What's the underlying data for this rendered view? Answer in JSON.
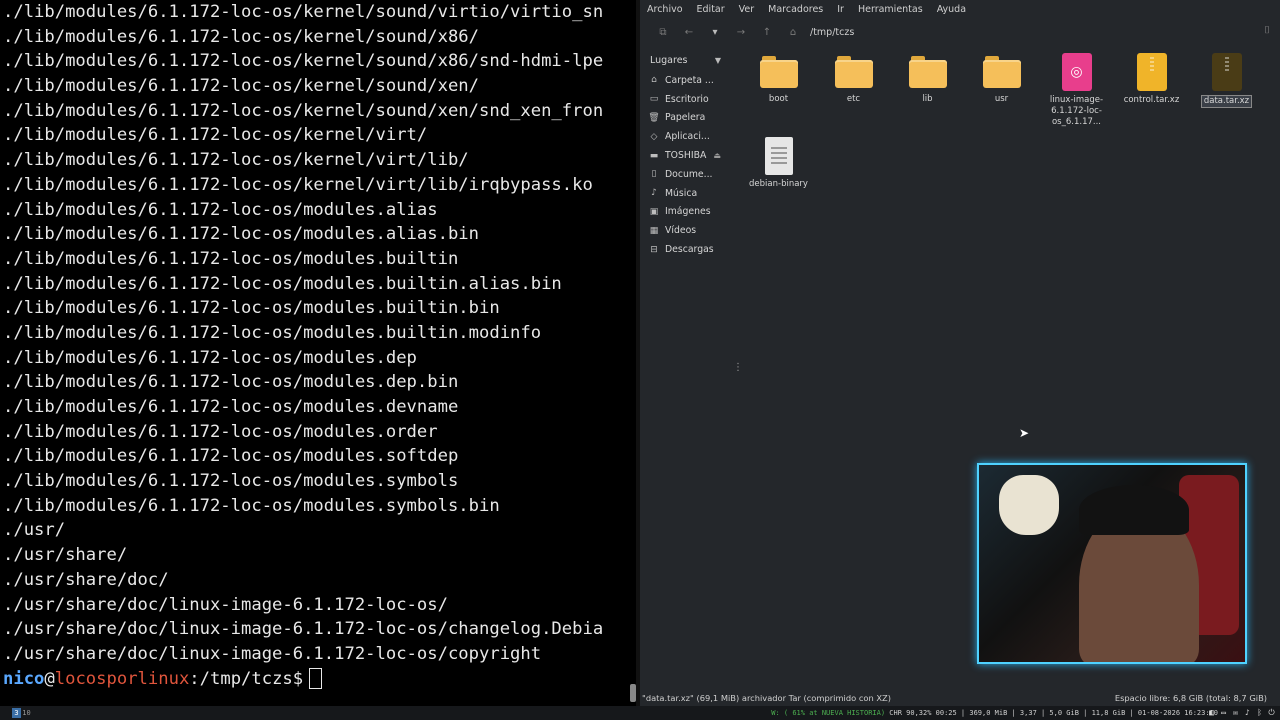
{
  "terminal": {
    "lines": [
      "./lib/modules/6.1.172-loc-os/kernel/sound/virtio/virtio_sn",
      "./lib/modules/6.1.172-loc-os/kernel/sound/x86/",
      "./lib/modules/6.1.172-loc-os/kernel/sound/x86/snd-hdmi-lpe",
      "./lib/modules/6.1.172-loc-os/kernel/sound/xen/",
      "./lib/modules/6.1.172-loc-os/kernel/sound/xen/snd_xen_fron",
      "./lib/modules/6.1.172-loc-os/kernel/virt/",
      "./lib/modules/6.1.172-loc-os/kernel/virt/lib/",
      "./lib/modules/6.1.172-loc-os/kernel/virt/lib/irqbypass.ko",
      "./lib/modules/6.1.172-loc-os/modules.alias",
      "./lib/modules/6.1.172-loc-os/modules.alias.bin",
      "./lib/modules/6.1.172-loc-os/modules.builtin",
      "./lib/modules/6.1.172-loc-os/modules.builtin.alias.bin",
      "./lib/modules/6.1.172-loc-os/modules.builtin.bin",
      "./lib/modules/6.1.172-loc-os/modules.builtin.modinfo",
      "./lib/modules/6.1.172-loc-os/modules.dep",
      "./lib/modules/6.1.172-loc-os/modules.dep.bin",
      "./lib/modules/6.1.172-loc-os/modules.devname",
      "./lib/modules/6.1.172-loc-os/modules.order",
      "./lib/modules/6.1.172-loc-os/modules.softdep",
      "./lib/modules/6.1.172-loc-os/modules.symbols",
      "./lib/modules/6.1.172-loc-os/modules.symbols.bin",
      "./usr/",
      "./usr/share/",
      "./usr/share/doc/",
      "./usr/share/doc/linux-image-6.1.172-loc-os/",
      "./usr/share/doc/linux-image-6.1.172-loc-os/changelog.Debia",
      "./usr/share/doc/linux-image-6.1.172-loc-os/copyright"
    ],
    "prompt": {
      "user": "nico",
      "at": "@",
      "host": "locosporlinux",
      "path": ":/tmp/tczs",
      "symbol": "$"
    }
  },
  "file_manager": {
    "menu": [
      "Archivo",
      "Editar",
      "Ver",
      "Marcadores",
      "Ir",
      "Herramientas",
      "Ayuda"
    ],
    "path": "/tmp/tczs",
    "sidebar_heading": "Lugares",
    "places": [
      {
        "label": "Carpeta ...",
        "icon": "home-icon"
      },
      {
        "label": "Escritorio",
        "icon": "desktop-icon"
      },
      {
        "label": "Papelera",
        "icon": "trash-icon"
      },
      {
        "label": "Aplicaci...",
        "icon": "applications-icon"
      },
      {
        "label": "TOSHIBA",
        "icon": "drive-icon"
      },
      {
        "label": "Docume...",
        "icon": "document-icon"
      },
      {
        "label": "Música",
        "icon": "music-icon"
      },
      {
        "label": "Imágenes",
        "icon": "image-icon"
      },
      {
        "label": "Vídeos",
        "icon": "video-icon"
      },
      {
        "label": "Descargas",
        "icon": "download-icon"
      }
    ],
    "files": [
      {
        "name": "boot",
        "type": "folder"
      },
      {
        "name": "etc",
        "type": "folder"
      },
      {
        "name": "lib",
        "type": "folder"
      },
      {
        "name": "usr",
        "type": "folder"
      },
      {
        "name": "linux-image-6.1.172-loc-os_6.1.17...",
        "type": "deb"
      },
      {
        "name": "control.tar.xz",
        "type": "archive"
      },
      {
        "name": "data.tar.xz",
        "type": "archive-selected"
      },
      {
        "name": "debian-binary",
        "type": "text"
      }
    ],
    "status_left": "\"data.tar.xz\" (69,1 MiB) archivador Tar (comprimido con XZ)",
    "status_right": "Espacio libre: 6,8 GiB (total: 8,7 GiB)"
  },
  "taskbar": {
    "workspaces": [
      "3",
      "10"
    ],
    "status_green": "W: ( 61% at NUEVA HISTORIA)",
    "status_rest": " CHR 90,32% 00:25 | 369,0 MiB | 3,37 | 5,0 GiB | 11,8 GiB | 01-08-2026 16:23:10"
  },
  "colors": {
    "prompt_user": "#5aa8ff",
    "prompt_host": "#e0553c",
    "webcam_border": "#4fd2ff",
    "folder": "#f5bf5a",
    "deb_file": "#e83e8c"
  }
}
